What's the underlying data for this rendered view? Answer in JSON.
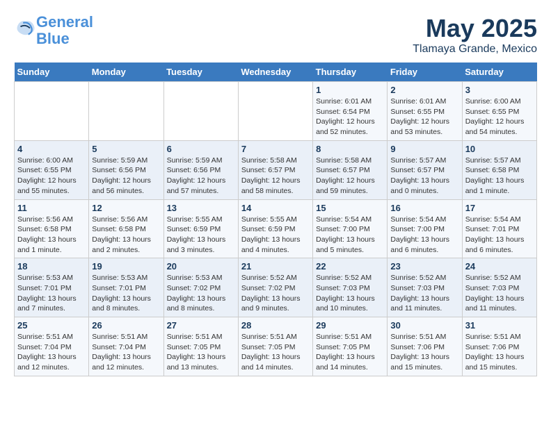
{
  "header": {
    "logo_line1": "General",
    "logo_line2": "Blue",
    "main_title": "May 2025",
    "subtitle": "Tlamaya Grande, Mexico"
  },
  "calendar": {
    "days_of_week": [
      "Sunday",
      "Monday",
      "Tuesday",
      "Wednesday",
      "Thursday",
      "Friday",
      "Saturday"
    ],
    "weeks": [
      [
        {
          "day": "",
          "detail": ""
        },
        {
          "day": "",
          "detail": ""
        },
        {
          "day": "",
          "detail": ""
        },
        {
          "day": "",
          "detail": ""
        },
        {
          "day": "1",
          "detail": "Sunrise: 6:01 AM\nSunset: 6:54 PM\nDaylight: 12 hours\nand 52 minutes."
        },
        {
          "day": "2",
          "detail": "Sunrise: 6:01 AM\nSunset: 6:55 PM\nDaylight: 12 hours\nand 53 minutes."
        },
        {
          "day": "3",
          "detail": "Sunrise: 6:00 AM\nSunset: 6:55 PM\nDaylight: 12 hours\nand 54 minutes."
        }
      ],
      [
        {
          "day": "4",
          "detail": "Sunrise: 6:00 AM\nSunset: 6:55 PM\nDaylight: 12 hours\nand 55 minutes."
        },
        {
          "day": "5",
          "detail": "Sunrise: 5:59 AM\nSunset: 6:56 PM\nDaylight: 12 hours\nand 56 minutes."
        },
        {
          "day": "6",
          "detail": "Sunrise: 5:59 AM\nSunset: 6:56 PM\nDaylight: 12 hours\nand 57 minutes."
        },
        {
          "day": "7",
          "detail": "Sunrise: 5:58 AM\nSunset: 6:57 PM\nDaylight: 12 hours\nand 58 minutes."
        },
        {
          "day": "8",
          "detail": "Sunrise: 5:58 AM\nSunset: 6:57 PM\nDaylight: 12 hours\nand 59 minutes."
        },
        {
          "day": "9",
          "detail": "Sunrise: 5:57 AM\nSunset: 6:57 PM\nDaylight: 13 hours\nand 0 minutes."
        },
        {
          "day": "10",
          "detail": "Sunrise: 5:57 AM\nSunset: 6:58 PM\nDaylight: 13 hours\nand 1 minute."
        }
      ],
      [
        {
          "day": "11",
          "detail": "Sunrise: 5:56 AM\nSunset: 6:58 PM\nDaylight: 13 hours\nand 1 minute."
        },
        {
          "day": "12",
          "detail": "Sunrise: 5:56 AM\nSunset: 6:58 PM\nDaylight: 13 hours\nand 2 minutes."
        },
        {
          "day": "13",
          "detail": "Sunrise: 5:55 AM\nSunset: 6:59 PM\nDaylight: 13 hours\nand 3 minutes."
        },
        {
          "day": "14",
          "detail": "Sunrise: 5:55 AM\nSunset: 6:59 PM\nDaylight: 13 hours\nand 4 minutes."
        },
        {
          "day": "15",
          "detail": "Sunrise: 5:54 AM\nSunset: 7:00 PM\nDaylight: 13 hours\nand 5 minutes."
        },
        {
          "day": "16",
          "detail": "Sunrise: 5:54 AM\nSunset: 7:00 PM\nDaylight: 13 hours\nand 6 minutes."
        },
        {
          "day": "17",
          "detail": "Sunrise: 5:54 AM\nSunset: 7:01 PM\nDaylight: 13 hours\nand 6 minutes."
        }
      ],
      [
        {
          "day": "18",
          "detail": "Sunrise: 5:53 AM\nSunset: 7:01 PM\nDaylight: 13 hours\nand 7 minutes."
        },
        {
          "day": "19",
          "detail": "Sunrise: 5:53 AM\nSunset: 7:01 PM\nDaylight: 13 hours\nand 8 minutes."
        },
        {
          "day": "20",
          "detail": "Sunrise: 5:53 AM\nSunset: 7:02 PM\nDaylight: 13 hours\nand 8 minutes."
        },
        {
          "day": "21",
          "detail": "Sunrise: 5:52 AM\nSunset: 7:02 PM\nDaylight: 13 hours\nand 9 minutes."
        },
        {
          "day": "22",
          "detail": "Sunrise: 5:52 AM\nSunset: 7:03 PM\nDaylight: 13 hours\nand 10 minutes."
        },
        {
          "day": "23",
          "detail": "Sunrise: 5:52 AM\nSunset: 7:03 PM\nDaylight: 13 hours\nand 11 minutes."
        },
        {
          "day": "24",
          "detail": "Sunrise: 5:52 AM\nSunset: 7:03 PM\nDaylight: 13 hours\nand 11 minutes."
        }
      ],
      [
        {
          "day": "25",
          "detail": "Sunrise: 5:51 AM\nSunset: 7:04 PM\nDaylight: 13 hours\nand 12 minutes."
        },
        {
          "day": "26",
          "detail": "Sunrise: 5:51 AM\nSunset: 7:04 PM\nDaylight: 13 hours\nand 12 minutes."
        },
        {
          "day": "27",
          "detail": "Sunrise: 5:51 AM\nSunset: 7:05 PM\nDaylight: 13 hours\nand 13 minutes."
        },
        {
          "day": "28",
          "detail": "Sunrise: 5:51 AM\nSunset: 7:05 PM\nDaylight: 13 hours\nand 14 minutes."
        },
        {
          "day": "29",
          "detail": "Sunrise: 5:51 AM\nSunset: 7:05 PM\nDaylight: 13 hours\nand 14 minutes."
        },
        {
          "day": "30",
          "detail": "Sunrise: 5:51 AM\nSunset: 7:06 PM\nDaylight: 13 hours\nand 15 minutes."
        },
        {
          "day": "31",
          "detail": "Sunrise: 5:51 AM\nSunset: 7:06 PM\nDaylight: 13 hours\nand 15 minutes."
        }
      ]
    ]
  }
}
